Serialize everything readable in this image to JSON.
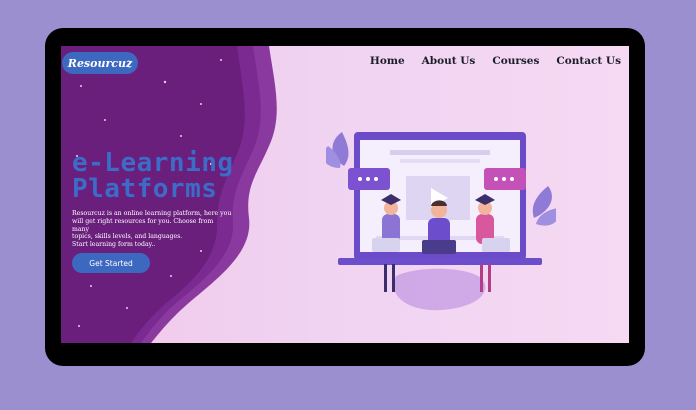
{
  "brand": {
    "logo_text": "Resourcuz"
  },
  "nav": {
    "items": [
      "Home",
      "About Us",
      "Courses",
      "Contact Us"
    ]
  },
  "hero": {
    "title_line1": "e-Learning",
    "title_line2": "Platforms",
    "description_lines": [
      "Resourcuz is an online learning platform, here you",
      "will get right resources for you. Choose from many",
      "topics, skills levels, and languages.",
      "Start learning form today.."
    ],
    "cta_label": "Get Started"
  },
  "colors": {
    "page_bg": "#9b8fcf",
    "frame": "#000000",
    "accent_blue": "#3d68c0",
    "deep_purple": "#6a1f7c",
    "screen_pink": "#f3c7ea"
  },
  "icons": {
    "illustration": "e-learning-students-laptop-illustration"
  }
}
